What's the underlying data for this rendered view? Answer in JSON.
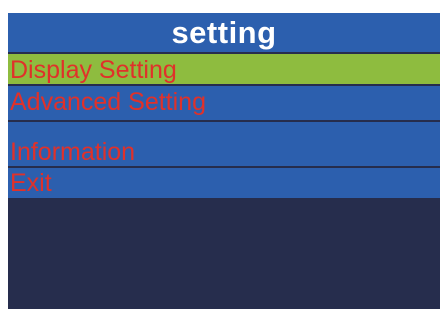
{
  "title": "setting",
  "menu": {
    "items": [
      {
        "label": "Display Setting",
        "selected": true
      },
      {
        "label": "Advanced Setting",
        "selected": false
      },
      {
        "label": "Information",
        "selected": false
      },
      {
        "label": "Exit",
        "selected": false
      }
    ]
  },
  "colors": {
    "title_bar": "#2c5fae",
    "title_text": "#ffffff",
    "item_bg": "#2c5fae",
    "item_selected_bg": "#8ebc3f",
    "item_text": "#e0312a",
    "screen_bg": "#262d4d",
    "separator": "#ffffff"
  }
}
